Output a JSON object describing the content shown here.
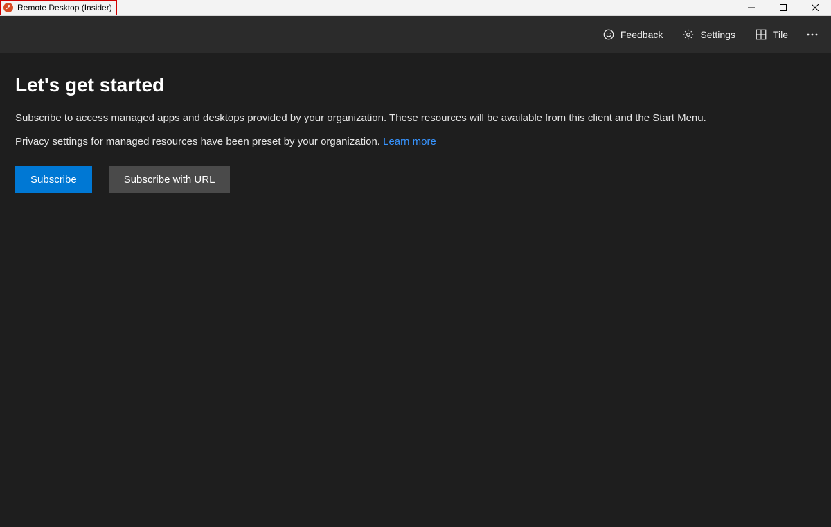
{
  "titlebar": {
    "title": "Remote Desktop (Insider)",
    "app_icon": "remote-desktop-icon"
  },
  "toolbar": {
    "feedback_label": "Feedback",
    "settings_label": "Settings",
    "tile_label": "Tile"
  },
  "main": {
    "heading": "Let's get started",
    "description": "Subscribe to access managed apps and desktops provided by your organization. These resources will be available from this client and the Start Menu.",
    "privacy_prefix": "Privacy settings for managed resources have been preset by your organization. ",
    "learn_more_label": "Learn more",
    "subscribe_label": "Subscribe",
    "subscribe_url_label": "Subscribe with URL"
  },
  "colors": {
    "accent": "#0078d4",
    "link": "#3794ff",
    "toolbar_bg": "#2b2b2b",
    "content_bg": "#1e1e1e",
    "titlebar_bg": "#f3f3f3"
  }
}
